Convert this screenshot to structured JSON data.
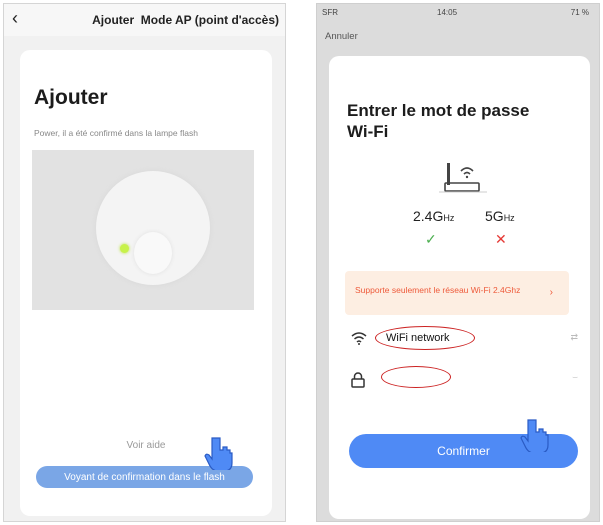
{
  "left": {
    "header": {
      "back_icon": "chevron-left-icon",
      "title": "Ajouter  Mode AP (point d'accès)"
    },
    "card": {
      "title": "Ajouter",
      "description": "Power, il a été confirmé dans la lampe flash",
      "image_icon": "lamp-image-icon"
    },
    "help_link": "Voir aide",
    "confirm_button": "Voyant de confirmation dans le flash"
  },
  "right": {
    "status_bar": {
      "carrier": "SFR",
      "time": "14:05",
      "battery": "71 %"
    },
    "cancel": "Annuler",
    "title_line1": "Entrer le mot de passe",
    "title_line2": "Wi-Fi",
    "bands": {
      "band_24": "2.4G",
      "band_24_unit": "Hz",
      "band_5": "5G",
      "band_5_unit": "Hz",
      "supported_icon": "checkmark-icon",
      "unsupported_icon": "cross-icon"
    },
    "warning": "Supporte seulement le réseau Wi-Fi 2.4Ghz",
    "wifi_network_value": "WiFi network",
    "wifi_field_icon": "wifi-icon",
    "password_field_icon": "lock-icon",
    "password_value": "",
    "confirm_button": "Confirmer"
  },
  "colors": {
    "accent_blue": "#4f8af5",
    "light_blue": "#7aa6e6",
    "annotation_red": "#cc2222",
    "warning_text": "#ee5a3a",
    "success_green": "#4caf50",
    "error_red": "#e53935"
  }
}
